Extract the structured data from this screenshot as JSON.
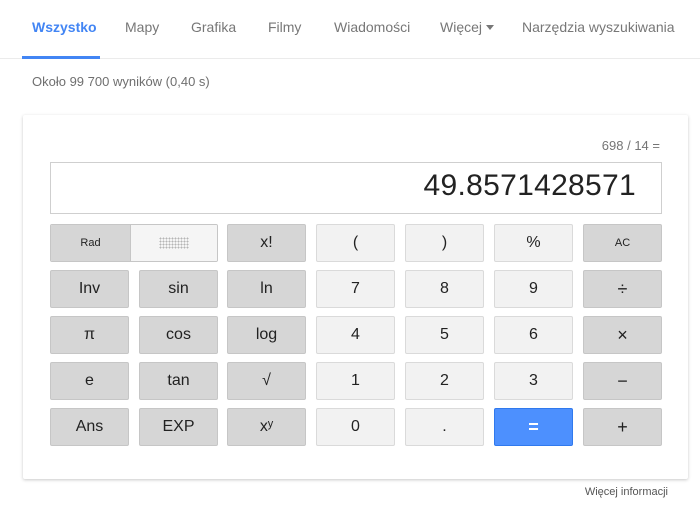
{
  "tabs": {
    "all": "Wszystko",
    "maps": "Mapy",
    "images": "Grafika",
    "videos": "Filmy",
    "news": "Wiadomości",
    "more": "Więcej",
    "tools": "Narzędzia wyszukiwania"
  },
  "result_stats": "Około 99 700 wyników (0,40 s)",
  "calculator": {
    "expression": "698 / 14 =",
    "display": "49.8571428571",
    "angle": {
      "rad": "Rad",
      "deg": "Deg"
    },
    "keys": {
      "factorial": "x!",
      "open_paren": "(",
      "close_paren": ")",
      "percent": "%",
      "clear": "AC",
      "inv": "Inv",
      "sin": "sin",
      "ln": "ln",
      "seven": "7",
      "eight": "8",
      "nine": "9",
      "divide": "÷",
      "pi": "π",
      "cos": "cos",
      "log": "log",
      "four": "4",
      "five": "5",
      "six": "6",
      "multiply": "×",
      "e": "e",
      "tan": "tan",
      "sqrt": "√",
      "one": "1",
      "two": "2",
      "three": "3",
      "minus": "−",
      "ans": "Ans",
      "exp": "EXP",
      "power": "xʸ",
      "zero": "0",
      "decimal": ".",
      "equals": "=",
      "plus": "+"
    }
  },
  "more_info": "Więcej informacji",
  "colors": {
    "accent": "#4285f4",
    "equals_button": "#4d90fe"
  }
}
